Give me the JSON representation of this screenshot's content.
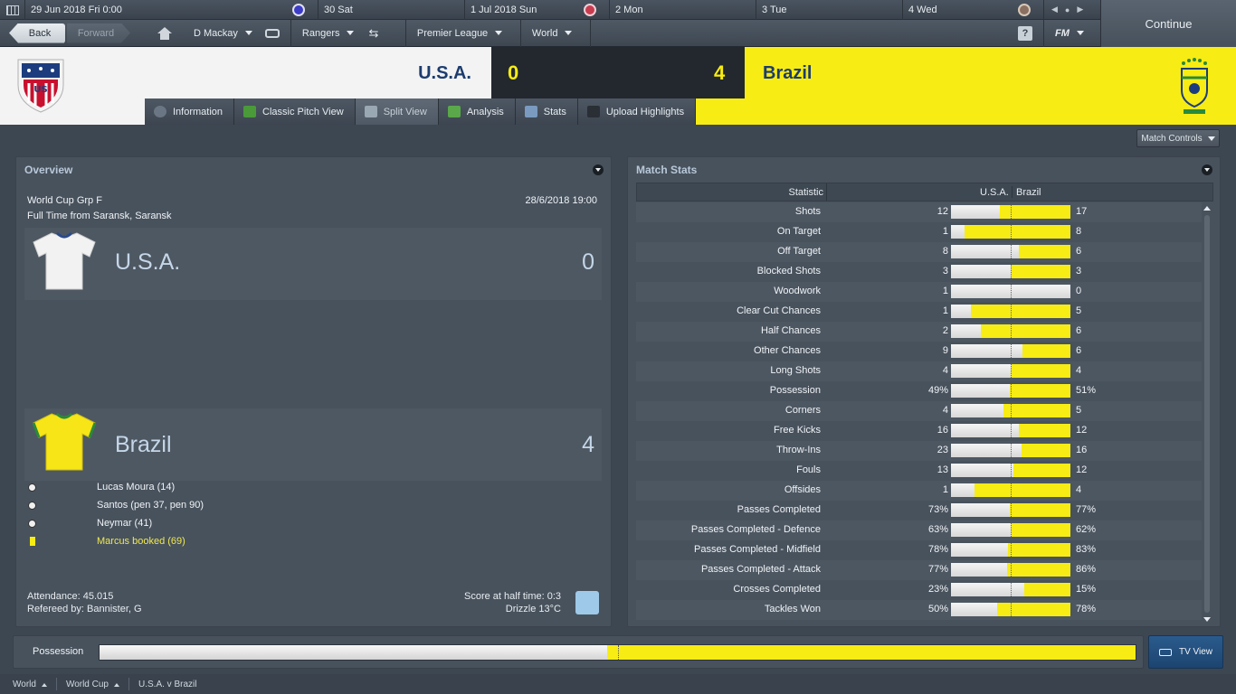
{
  "calendar": {
    "cells": [
      {
        "label": "29 Jun 2018  Fri  0:00",
        "marker": "#3c3cc8"
      },
      {
        "label": "30  Sat",
        "marker": ""
      },
      {
        "label": "1 Jul 2018  Sun",
        "marker": "#c83c50"
      },
      {
        "label": "2  Mon",
        "marker": ""
      },
      {
        "label": "3  Tue",
        "marker": ""
      },
      {
        "label": "4  Wed",
        "marker": "#8a7060"
      }
    ]
  },
  "toolbar": {
    "back_label": "Back",
    "forward_label": "Forward",
    "manager": "D Mackay",
    "club": "Rangers",
    "league": "Premier League",
    "world": "World",
    "help": "?",
    "fm": "FM",
    "continue_label": "Continue"
  },
  "header": {
    "home_team": "U.S.A.",
    "away_team": "Brazil",
    "home_score": "0",
    "away_score": "4"
  },
  "tabs": [
    {
      "label": "Information",
      "icon": "info-icon",
      "color": "#6a7684"
    },
    {
      "label": "Classic Pitch View",
      "icon": "pitch-icon",
      "color": "#4a9a3a"
    },
    {
      "label": "Split View",
      "icon": "split-view-icon",
      "color": "#9aa8b4"
    },
    {
      "label": "Analysis",
      "icon": "analysis-icon",
      "color": "#5aa84a"
    },
    {
      "label": "Stats",
      "icon": "stats-icon",
      "color": "#7a9ac0"
    },
    {
      "label": "Upload Highlights",
      "icon": "camera-icon",
      "color": "#2a2f35"
    }
  ],
  "match_controls": "Match Controls",
  "overview": {
    "title": "Overview",
    "competition": "World Cup Grp F",
    "venue": "Full Time from Saransk, Saransk",
    "datetime": "28/6/2018 19:00",
    "home": {
      "name": "U.S.A.",
      "score": "0"
    },
    "away": {
      "name": "Brazil",
      "score": "4"
    },
    "events": [
      {
        "type": "goal",
        "text": "Lucas Moura (14)"
      },
      {
        "type": "goal",
        "text": "Santos (pen 37, pen 90)"
      },
      {
        "type": "goal",
        "text": "Neymar (41)"
      },
      {
        "type": "booking",
        "text": "Marcus booked (69)"
      }
    ],
    "attendance": "Attendance: 45.015",
    "referee": "Refereed by: Bannister, G",
    "half_time": "Score at half time: 0:3",
    "weather": "Drizzle 13°C"
  },
  "stats": {
    "title": "Match Stats",
    "col_stat": "Statistic",
    "col_home": "U.S.A.",
    "col_away": "Brazil",
    "rows": [
      {
        "name": "Shots",
        "home": "12",
        "away": "17",
        "share": 0.41
      },
      {
        "name": "On Target",
        "home": "1",
        "away": "8",
        "share": 0.11
      },
      {
        "name": "Off Target",
        "home": "8",
        "away": "6",
        "share": 0.57
      },
      {
        "name": "Blocked Shots",
        "home": "3",
        "away": "3",
        "share": 0.5
      },
      {
        "name": "Woodwork",
        "home": "1",
        "away": "0",
        "share": 1.0
      },
      {
        "name": "Clear Cut Chances",
        "home": "1",
        "away": "5",
        "share": 0.17
      },
      {
        "name": "Half Chances",
        "home": "2",
        "away": "6",
        "share": 0.25
      },
      {
        "name": "Other Chances",
        "home": "9",
        "away": "6",
        "share": 0.6
      },
      {
        "name": "Long Shots",
        "home": "4",
        "away": "4",
        "share": 0.5
      },
      {
        "name": "Possession",
        "home": "49%",
        "away": "51%",
        "share": 0.49
      },
      {
        "name": "Corners",
        "home": "4",
        "away": "5",
        "share": 0.44
      },
      {
        "name": "Free Kicks",
        "home": "16",
        "away": "12",
        "share": 0.57
      },
      {
        "name": "Throw-Ins",
        "home": "23",
        "away": "16",
        "share": 0.59
      },
      {
        "name": "Fouls",
        "home": "13",
        "away": "12",
        "share": 0.52
      },
      {
        "name": "Offsides",
        "home": "1",
        "away": "4",
        "share": 0.2
      },
      {
        "name": "Passes Completed",
        "home": "73%",
        "away": "77%",
        "share": 0.49
      },
      {
        "name": "Passes Completed - Defence",
        "home": "63%",
        "away": "62%",
        "share": 0.5
      },
      {
        "name": "Passes Completed - Midfield",
        "home": "78%",
        "away": "83%",
        "share": 0.48
      },
      {
        "name": "Passes Completed - Attack",
        "home": "77%",
        "away": "86%",
        "share": 0.47
      },
      {
        "name": "Crosses Completed",
        "home": "23%",
        "away": "15%",
        "share": 0.61
      },
      {
        "name": "Tackles Won",
        "home": "50%",
        "away": "78%",
        "share": 0.39
      }
    ]
  },
  "possession": {
    "label": "Possession",
    "home_share": 0.49
  },
  "tv_view": "TV View",
  "breadcrumbs": [
    "World",
    "World Cup",
    "U.S.A. v Brazil"
  ],
  "colors": {
    "accent_yellow": "#f7ec13",
    "navy": "#1c3c6e",
    "panel": "#48525d"
  }
}
